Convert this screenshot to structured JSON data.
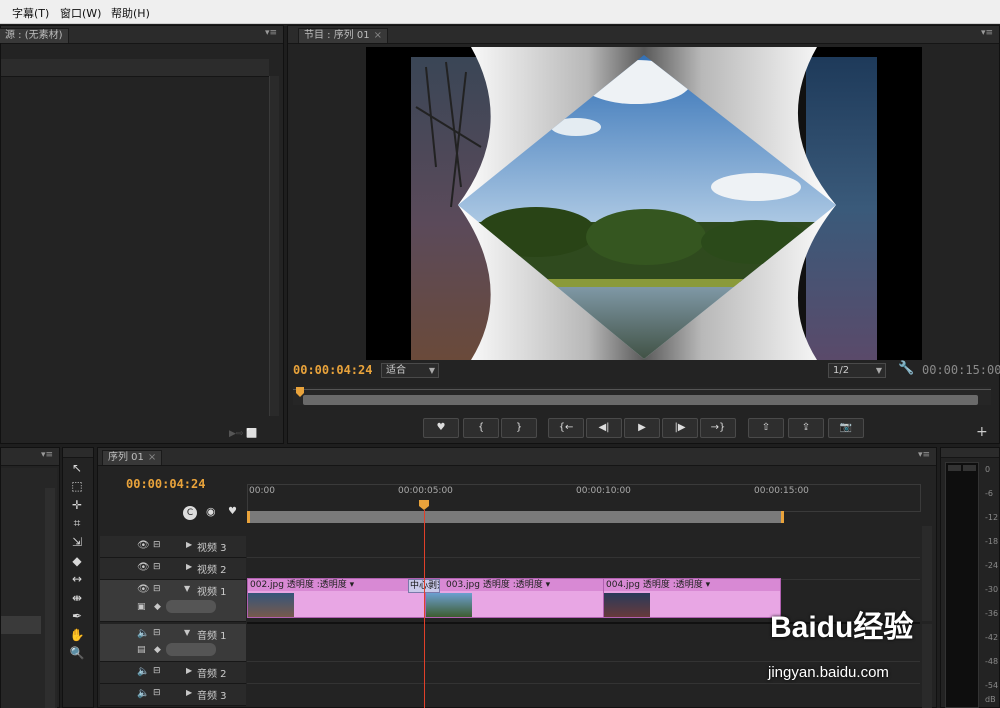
{
  "menu": [
    "字幕(T)",
    "窗口(W)",
    "帮助(H)"
  ],
  "source_panel": {
    "title": "源 : (无素材)"
  },
  "program_monitor": {
    "tab": "节目 : 序列 01",
    "current_time": "00:00:04:24",
    "fit_label": "适合",
    "resolution": "1/2",
    "duration": "00:00:15:00"
  },
  "timeline": {
    "tab": "序列 01",
    "current_time": "00:00:04:24",
    "ruler": [
      "00:00",
      "00:00:05:00",
      "00:00:10:00",
      "00:00:15:00"
    ],
    "tracks": [
      {
        "label": "视频 3"
      },
      {
        "label": "视频 2"
      },
      {
        "label": "视频 1"
      },
      {
        "label": "音频 1"
      },
      {
        "label": "音频 2"
      },
      {
        "label": "音频 3"
      }
    ],
    "clips": [
      {
        "name": "002.jpg",
        "effect": "透明度 :透明度"
      },
      {
        "name": "003.jpg",
        "effect": "透明度 :透明度"
      },
      {
        "name": "004.jpg",
        "effect": "透明度 :透明度"
      }
    ],
    "transition_label": "中心剥落"
  },
  "audio_meter": {
    "labels": [
      "0",
      "-6",
      "-12",
      "-18",
      "-24",
      "-30",
      "-36",
      "-42",
      "-48",
      "-54",
      "dB"
    ]
  },
  "watermark": {
    "brand": "Baidu经验",
    "url": "jingyan.baidu.com"
  },
  "colors": {
    "accent": "#e9a33b",
    "clip": "#e8a6e4",
    "playhead": "#e0402a"
  }
}
